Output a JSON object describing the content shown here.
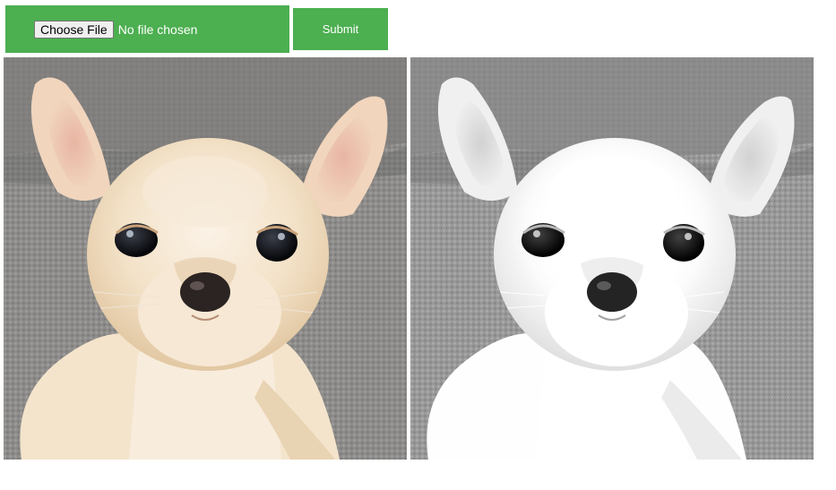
{
  "upload": {
    "choose_label": "Choose File",
    "status": "No file chosen"
  },
  "submit_label": "Submit",
  "images": [
    {
      "name": "original-image",
      "icon": "puppy-photo",
      "mode": "color"
    },
    {
      "name": "grayscale-image",
      "icon": "puppy-photo",
      "mode": "grayscale"
    }
  ],
  "colors": {
    "accent": "#4caf50",
    "button_text": "#ffffff"
  }
}
